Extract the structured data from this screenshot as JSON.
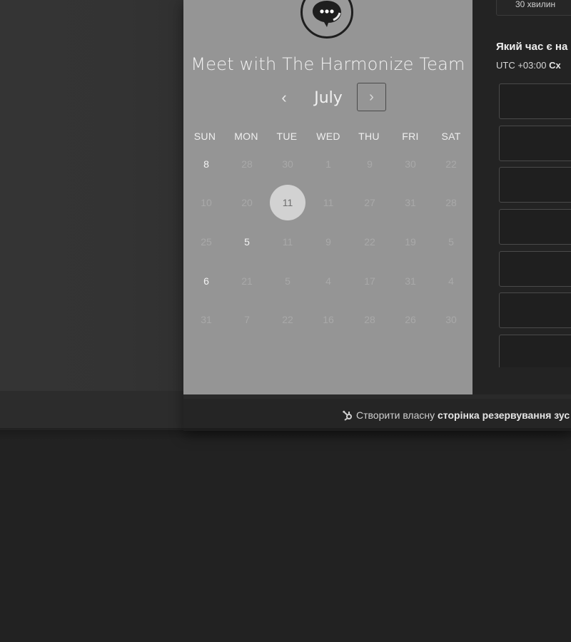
{
  "booking": {
    "title": "Meet with The Harmonize Team",
    "month": "July",
    "weekdays": [
      "SUN",
      "MON",
      "TUE",
      "WED",
      "THU",
      "FRI",
      "SAT"
    ],
    "days": [
      [
        "8",
        "28",
        "30",
        "1",
        "9",
        "30",
        "22"
      ],
      [
        "10",
        "20",
        "11",
        "11",
        "27",
        "31",
        "28"
      ],
      [
        "25",
        "5",
        "11",
        "9",
        "22",
        "19",
        "5"
      ],
      [
        "6",
        "21",
        "5",
        "4",
        "17",
        "31",
        "4"
      ],
      [
        "31",
        "7",
        "22",
        "16",
        "28",
        "26",
        "30"
      ]
    ],
    "available_days": [
      "8",
      "5",
      "6"
    ],
    "selected_day": "11"
  },
  "time_panel": {
    "duration": "30 хвилин",
    "question": "Який час є на",
    "timezone_offset": "UTC +03:00",
    "timezone_name": "Сх"
  },
  "footer": {
    "prefix": "Створити власну",
    "bold": "сторінка резервування зус"
  },
  "icons": {
    "avatar": "chat-bubble-icon",
    "prev": "chevron-left-icon",
    "next": "chevron-right-icon",
    "footer": "hubspot-sprocket-icon"
  }
}
